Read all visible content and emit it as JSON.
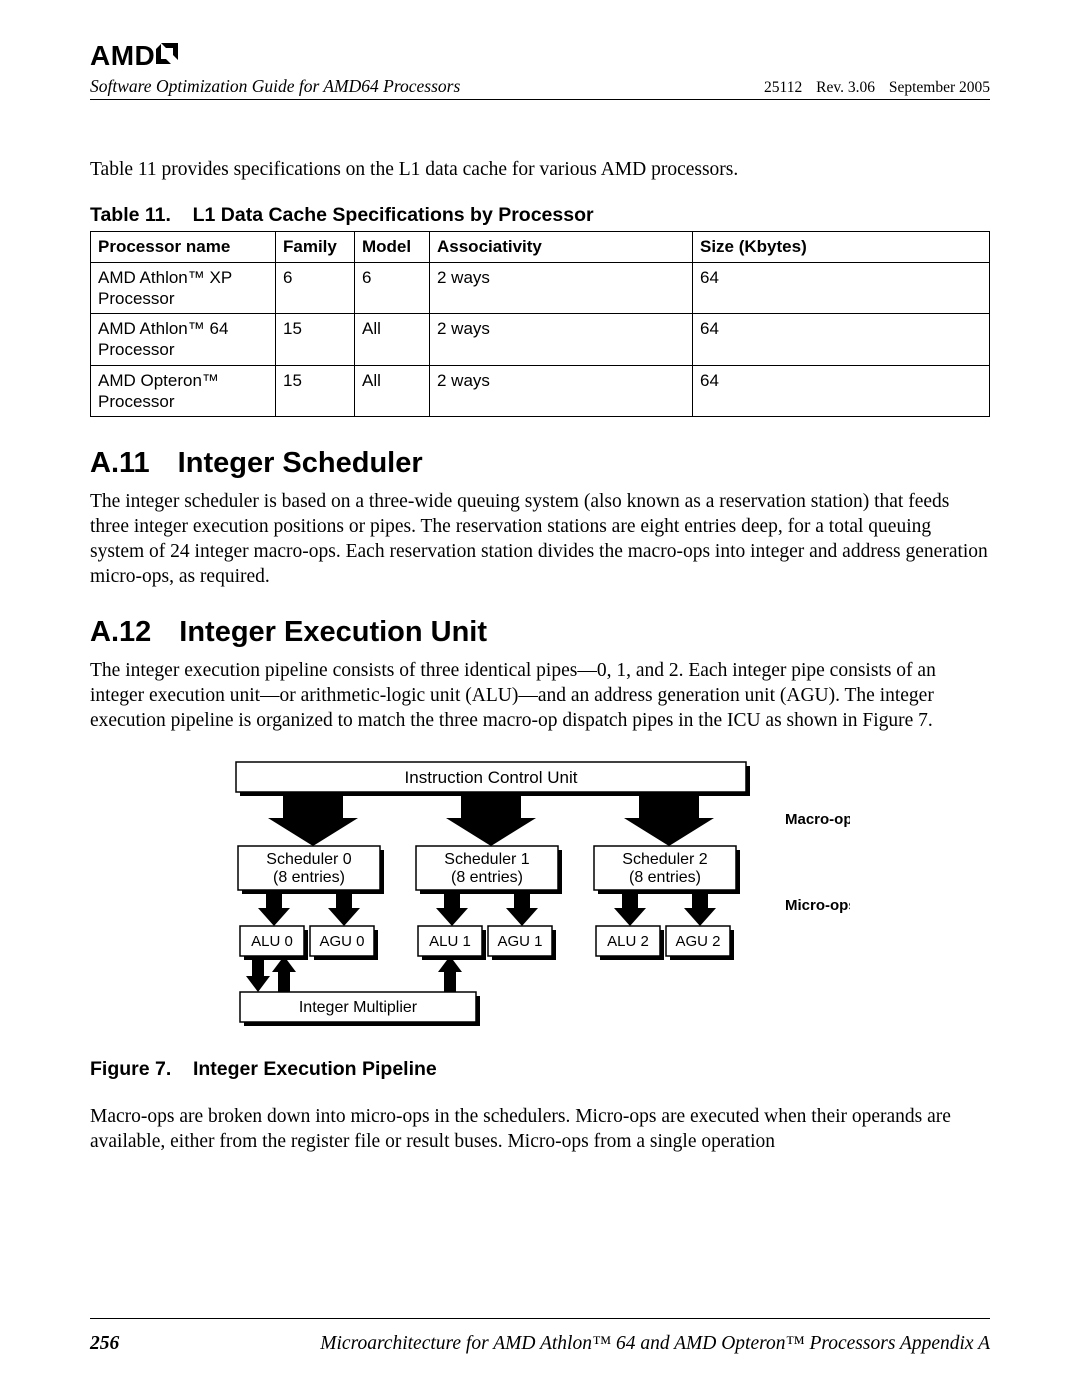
{
  "brand": "AMD",
  "header": {
    "title": "Software Optimization Guide for AMD64 Processors",
    "docnum": "25112",
    "rev": "Rev. 3.06",
    "date": "September 2005"
  },
  "intro": "Table 11 provides specifications on the L1 data cache for various AMD processors.",
  "table": {
    "caption_no": "Table 11.",
    "caption_title": "L1 Data Cache Specifications by Processor",
    "headers": [
      "Processor name",
      "Family",
      "Model",
      "Associativity",
      "Size (Kbytes)"
    ],
    "rows": [
      {
        "name": "AMD Athlon™ XP Processor",
        "family": "6",
        "model": "6",
        "assoc": "2 ways",
        "size": "64"
      },
      {
        "name": "AMD Athlon™ 64 Processor",
        "family": "15",
        "model": "All",
        "assoc": "2 ways",
        "size": "64"
      },
      {
        "name": "AMD Opteron™ Processor",
        "family": "15",
        "model": "All",
        "assoc": "2 ways",
        "size": "64"
      }
    ]
  },
  "sections": {
    "a11": {
      "no": "A.11",
      "title": "Integer Scheduler",
      "body": "The integer scheduler is based on a three-wide queuing system (also known as a reservation station) that feeds three integer execution positions or pipes. The reservation stations are eight entries deep, for a total queuing system of 24 integer macro-ops. Each reservation station divides the macro-ops into integer and address generation micro-ops, as required."
    },
    "a12": {
      "no": "A.12",
      "title": "Integer Execution Unit",
      "body": "The integer execution pipeline consists of three identical pipes—0, 1, and 2. Each integer pipe consists of an integer execution unit—or arithmetic-logic unit (ALU)—and an address generation unit (AGU). The integer execution pipeline is organized to match the three macro-op dispatch pipes in the ICU as shown in Figure 7.",
      "body2": "Macro-ops are broken down into micro-ops in the schedulers. Micro-ops are executed when their operands are available, either from the register file or result buses. Micro-ops from a single operation"
    }
  },
  "figure": {
    "caption_no": "Figure 7.",
    "caption_title": "Integer Execution Pipeline",
    "icu": "Instruction Control Unit",
    "macro_label": "Macro-ops",
    "micro_label": "Micro-ops",
    "sched": [
      {
        "line1": "Scheduler 0",
        "line2": "(8 entries)"
      },
      {
        "line1": "Scheduler 1",
        "line2": "(8 entries)"
      },
      {
        "line1": "Scheduler 2",
        "line2": "(8 entries)"
      }
    ],
    "units": [
      "ALU 0",
      "AGU 0",
      "ALU 1",
      "AGU 1",
      "ALU 2",
      "AGU 2"
    ],
    "mult": "Integer Multiplier"
  },
  "footer": {
    "pageno": "256",
    "text": "Microarchitecture for AMD Athlon™ 64 and AMD Opteron™ Processors   Appendix A"
  }
}
